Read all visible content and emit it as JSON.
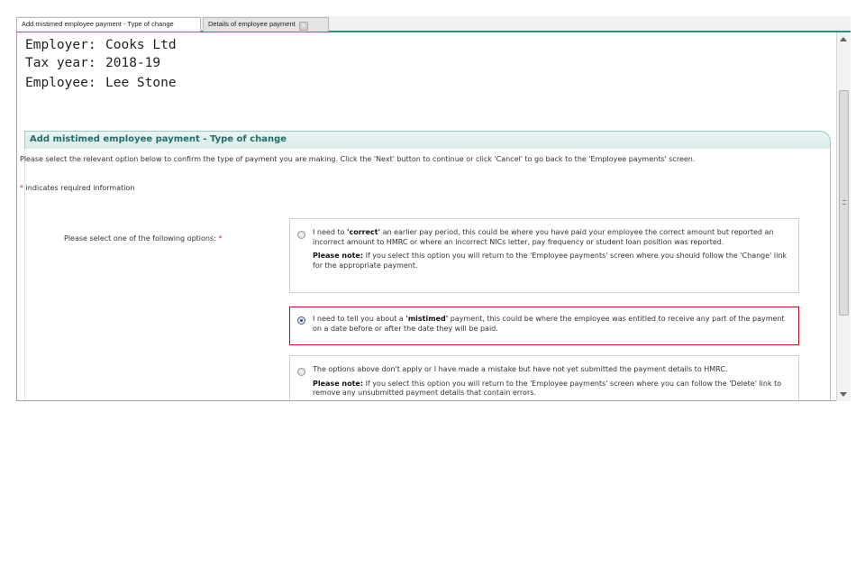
{
  "tabs": [
    {
      "label": "Add mistimed employee payment - Type of change",
      "active": true
    },
    {
      "label": "Details of employee payment",
      "active": false,
      "closable": true
    }
  ],
  "header": {
    "employer_label": "Employer:",
    "employer_value": "Cooks Ltd",
    "taxyear_label": "Tax year:",
    "taxyear_value": "2018-19",
    "employee_label": "Employee:",
    "employee_value": "Lee Stone"
  },
  "section": {
    "title": "Add mistimed employee payment - Type of change",
    "intro": "Please select the relevant option below to confirm the type of payment you are making. Click the 'Next' button to continue or click 'Cancel' to go back to the 'Employee payments' screen.",
    "required_marker": "*",
    "required_text": "indicates required information",
    "options_label": "Please select one of the following options:"
  },
  "options": [
    {
      "selected": false,
      "pre": "I need to ",
      "bold": "'correct'",
      "post": " an earlier pay period, this could be where you have paid your employee the correct amount but reported an incorrect amount to HMRC or where an incorrect NICs letter, pay frequency or student loan position was reported.",
      "note_label": "Please note:",
      "note_text": " If you select this option you will return to the 'Employee payments' screen where you should follow the 'Change' link for the appropriate payment."
    },
    {
      "selected": true,
      "pre": "I need to tell you about a ",
      "bold": "'mistimed'",
      "post": " payment, this could be where the employee was entitled to receive any part of the payment on a date before or after the date they will be paid."
    },
    {
      "selected": false,
      "pre": "The options above don't apply or I have made a mistake but have not yet submitted the payment details to HMRC.",
      "note_label": "Please note:",
      "note_text": " If you select this option you will return to the 'Employee payments' screen where you can follow the 'Delete' link to remove any unsubmitted payment details that contain errors."
    }
  ],
  "colors": {
    "accent": "#2f8c82",
    "section_title": "#256d66",
    "selected_border": "#c4141a",
    "required": "#d0302f"
  },
  "icons": {
    "tab_close": "close-icon",
    "scroll_up": "arrow-up-icon",
    "scroll_down": "arrow-down-icon"
  }
}
